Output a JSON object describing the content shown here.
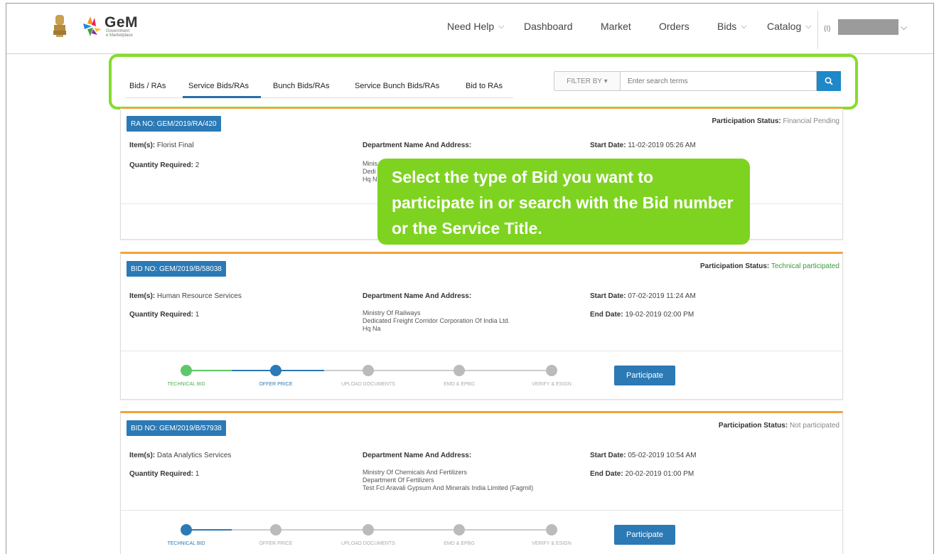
{
  "header": {
    "logo_title": "GeM",
    "logo_subtitle_1": "Government",
    "logo_subtitle_2": "e Marketplace",
    "nav": [
      {
        "label": "Need Help",
        "dropdown": true
      },
      {
        "label": "Dashboard",
        "dropdown": false
      },
      {
        "label": "Market",
        "dropdown": false
      },
      {
        "label": "Orders",
        "dropdown": false
      },
      {
        "label": "Bids",
        "dropdown": true
      },
      {
        "label": "Catalog",
        "dropdown": true
      }
    ],
    "user_prefix": "(I)"
  },
  "tabs": [
    "Bids / RAs",
    "Service Bids/RAs",
    "Bunch Bids/RAs",
    "Service Bunch Bids/RAs",
    "Bid to RAs"
  ],
  "active_tab": "Service Bids/RAs",
  "filter": {
    "label": "FILTER BY ▾",
    "placeholder": "Enter search terms"
  },
  "callout": {
    "text": "Select the type of Bid you want to participate in or search with the Bid number or the Service Title."
  },
  "labels": {
    "participation_status": "Participation Status:",
    "items": "Item(s):",
    "quantity": "Quantity Required:",
    "department": "Department Name And Address:",
    "start_date": "Start Date:",
    "end_date": "End Date:",
    "participate": "Participate"
  },
  "steps": [
    "TECHNICAL BID",
    "OFFER PRICE",
    "UPLOAD DOCUMENTS",
    "EMD & EPBG",
    "VERIFY & ESIGN"
  ],
  "cards": [
    {
      "number": "RA NO: GEM/2019/RA/420",
      "status": "Financial Pending",
      "items": "Florist Final",
      "quantity": "2",
      "address": [
        "Minis",
        "Dedi",
        "Hq N"
      ],
      "start_date": "11-02-2019 05:26 AM"
    },
    {
      "number": "BID NO: GEM/2019/B/58038",
      "status": "Technical participated",
      "items": "Human Resource Services",
      "quantity": "1",
      "address": [
        "Ministry Of Railways",
        "Dedicated Freight Corridor Corporation Of India Ltd.",
        "Hq Na"
      ],
      "start_date": "07-02-2019 11:24 AM",
      "end_date": "19-02-2019 02:00 PM"
    },
    {
      "number": "BID NO: GEM/2019/B/57938",
      "status": "Not participated",
      "items": "Data Analytics Services",
      "quantity": "1",
      "address": [
        "Ministry Of Chemicals And Fertilizers",
        "Department Of Fertilizers",
        "Test Fcl Aravali Gypsum And Minerals India Limited (Fagmil)"
      ],
      "start_date": "05-02-2019 10:54 AM",
      "end_date": "20-02-2019 01:00 PM"
    }
  ],
  "colors": {
    "accent": "#2b79b5",
    "callout": "#7ed321",
    "highlight": "#86dc2b",
    "card_top": "#f2a23a"
  }
}
